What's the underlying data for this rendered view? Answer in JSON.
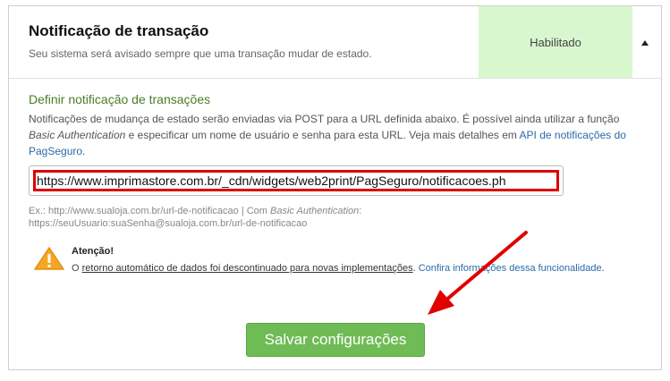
{
  "header": {
    "title": "Notificação de transação",
    "subtitle": "Seu sistema será avisado sempre que uma transação mudar de estado.",
    "status": "Habilitado",
    "collapse_icon": "caret-up-icon"
  },
  "section": {
    "title": "Definir notificação de transações",
    "desc_part1": "Notificações de mudança de estado serão enviadas via POST para a URL definida abaixo. É possível ainda utilizar a função ",
    "desc_em": "Basic Authentication",
    "desc_part2": " e especificar um nome de usuário e senha para esta URL. Veja mais detalhes em ",
    "desc_link": "API de notificações do PagSeguro",
    "desc_end": "."
  },
  "url_field": {
    "value": "https://www.imprimastore.com.br/_cdn/widgets/web2print/PagSeguro/notificacoes.ph"
  },
  "example": {
    "part1": "Ex.: http://www.sualoja.com.br/url-de-notificacao | Com ",
    "em": "Basic Authentication",
    "part2": ":",
    "line2": "https://seuUsuario:suaSenha@sualoja.com.br/url-de-notificacao"
  },
  "alert": {
    "icon": "warning-icon",
    "title": "Atenção!",
    "prefix": "O ",
    "underlined": "retorno automático de dados foi descontinuado para novas implementações",
    "middle": ". ",
    "link": "Confira informações dessa funcionalidade",
    "end": "."
  },
  "actions": {
    "save_label": "Salvar configurações"
  },
  "colors": {
    "status_bg": "#d9f7cf",
    "save_button": "#6fbb55",
    "highlight": "#e00000",
    "arrow": "#e00000",
    "section_title": "#4a7c2a"
  }
}
